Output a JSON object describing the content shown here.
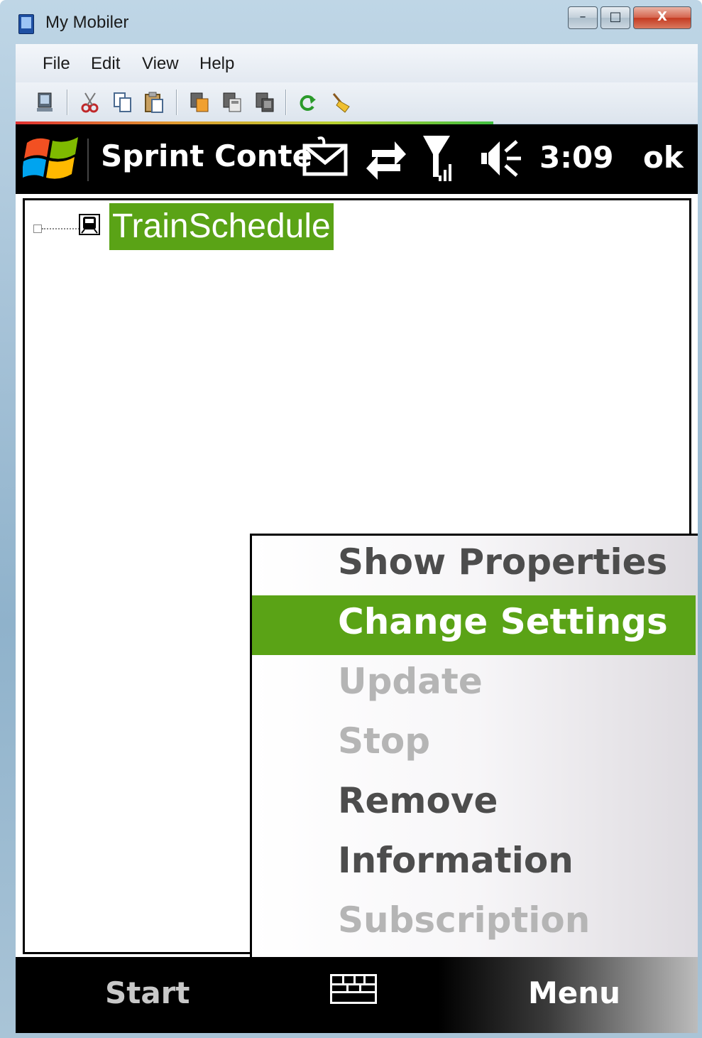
{
  "window": {
    "title": "My Mobiler",
    "min_glyph": "–",
    "max_glyph": "□",
    "close_glyph": "X"
  },
  "menubar": {
    "items": [
      {
        "label": "File",
        "name": "menu-file"
      },
      {
        "label": "Edit",
        "name": "menu-edit"
      },
      {
        "label": "View",
        "name": "menu-view"
      },
      {
        "label": "Help",
        "name": "menu-help"
      }
    ]
  },
  "toolbar": {
    "icons": [
      "device-icon",
      "cut-icon",
      "copy-icon",
      "paste-icon",
      "copy-to-device-icon",
      "copy-from-device-icon",
      "capture-icon",
      "refresh-icon",
      "clean-icon"
    ]
  },
  "progress": {
    "value": 0.7
  },
  "device": {
    "status": {
      "title": "Sprint Conte",
      "time": "3:09",
      "ok": "ok",
      "icons": [
        "message-icon",
        "data-sync-icon",
        "signal-icon",
        "volume-icon"
      ]
    },
    "tree": {
      "node_label": "TrainSchedule"
    },
    "context_menu": {
      "items": [
        {
          "label": "Show Properties",
          "state": "enabled"
        },
        {
          "label": "Change Settings",
          "state": "selected"
        },
        {
          "label": "Update",
          "state": "disabled"
        },
        {
          "label": "Stop",
          "state": "disabled"
        },
        {
          "label": "Remove",
          "state": "enabled"
        },
        {
          "label": "Information",
          "state": "enabled"
        },
        {
          "label": "Subscription",
          "state": "disabled"
        }
      ]
    },
    "softkeys": {
      "left": "Start",
      "right": "Menu"
    }
  },
  "colors": {
    "selection": "#5aa316",
    "status_bar": "#000000",
    "disabled_text": "#b5b5b5"
  }
}
